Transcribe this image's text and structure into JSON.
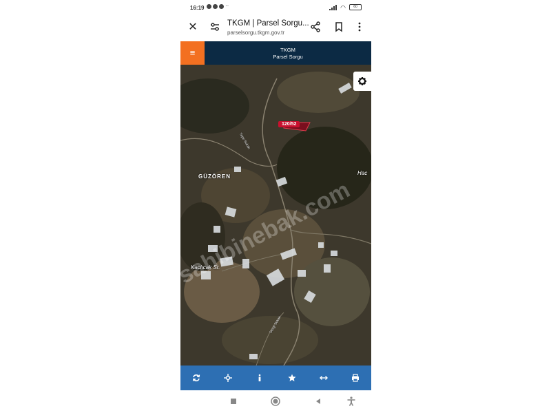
{
  "status_bar": {
    "time": "16:19",
    "battery": "60"
  },
  "browser": {
    "title": "TKGM | Parsel Sorgu...",
    "url": "parselsorgu.tkgm.gov.tr"
  },
  "header": {
    "title_line1": "TKGM",
    "title_line2": "Parsel Sorgu"
  },
  "map": {
    "place_label_1": "GÜZÖREN",
    "place_label_2": "Hac",
    "place_label_3": "Kaclıcak Sr.",
    "road_label_1": "Tepe Sokak",
    "road_label_2": "Sevgi Sokak",
    "parcel_label": "120/52",
    "watermark": "sahibinebak.com"
  },
  "toolbar": {
    "items": [
      "refresh-icon",
      "locate-icon",
      "info-icon",
      "star-icon",
      "measure-icon",
      "print-icon"
    ]
  },
  "colors": {
    "header_bg": "#0c2a44",
    "menu_accent": "#f37021",
    "toolbar_bg": "#2d6fb3",
    "parcel": "#c8102e"
  }
}
